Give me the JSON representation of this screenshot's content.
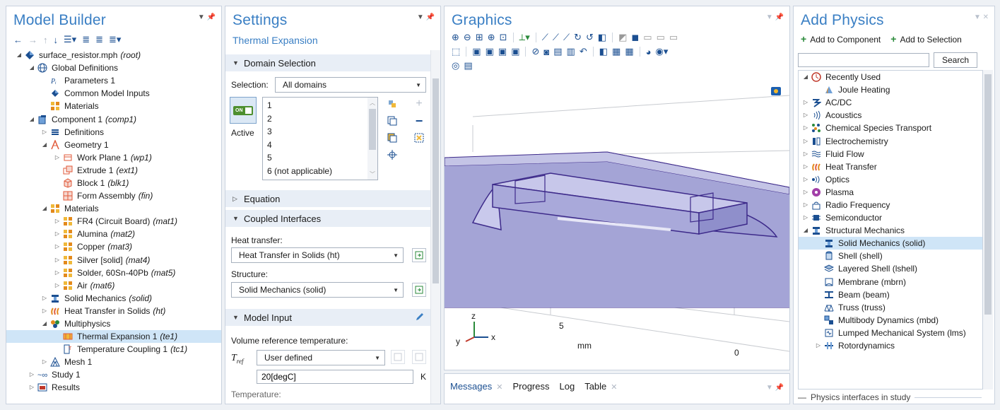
{
  "model_builder": {
    "title": "Model Builder",
    "tree": [
      {
        "depth": 0,
        "expanded": true,
        "icon": "model-root-icon",
        "label": "surface_resistor.mph",
        "tag": "(root)"
      },
      {
        "depth": 1,
        "expanded": true,
        "icon": "globe-icon",
        "label": "Global Definitions",
        "tag": ""
      },
      {
        "depth": 2,
        "expanded": null,
        "icon": "parameters-icon",
        "label": "Parameters 1",
        "tag": ""
      },
      {
        "depth": 2,
        "expanded": null,
        "icon": "common-inputs-icon",
        "label": "Common Model Inputs",
        "tag": ""
      },
      {
        "depth": 2,
        "expanded": null,
        "icon": "materials-icon",
        "label": "Materials",
        "tag": ""
      },
      {
        "depth": 1,
        "expanded": true,
        "icon": "component-icon",
        "label": "Component 1",
        "tag": "(comp1)"
      },
      {
        "depth": 2,
        "expanded": false,
        "icon": "definitions-icon",
        "label": "Definitions",
        "tag": ""
      },
      {
        "depth": 2,
        "expanded": true,
        "icon": "geometry-icon",
        "label": "Geometry 1",
        "tag": ""
      },
      {
        "depth": 3,
        "expanded": false,
        "icon": "work-plane-icon",
        "label": "Work Plane 1",
        "tag": "(wp1)"
      },
      {
        "depth": 3,
        "expanded": null,
        "icon": "extrude-icon",
        "label": "Extrude 1",
        "tag": "(ext1)"
      },
      {
        "depth": 3,
        "expanded": null,
        "icon": "block-icon",
        "label": "Block 1",
        "tag": "(blk1)"
      },
      {
        "depth": 3,
        "expanded": null,
        "icon": "form-assembly-icon",
        "label": "Form Assembly",
        "tag": "(fin)"
      },
      {
        "depth": 2,
        "expanded": true,
        "icon": "materials-icon",
        "label": "Materials",
        "tag": ""
      },
      {
        "depth": 3,
        "expanded": false,
        "icon": "material-icon",
        "label": "FR4 (Circuit Board)",
        "tag": "(mat1)"
      },
      {
        "depth": 3,
        "expanded": false,
        "icon": "material-icon",
        "label": "Alumina",
        "tag": "(mat2)"
      },
      {
        "depth": 3,
        "expanded": false,
        "icon": "material-icon",
        "label": "Copper",
        "tag": "(mat3)"
      },
      {
        "depth": 3,
        "expanded": false,
        "icon": "material-icon",
        "label": "Silver [solid]",
        "tag": "(mat4)"
      },
      {
        "depth": 3,
        "expanded": false,
        "icon": "material-icon",
        "label": "Solder, 60Sn-40Pb",
        "tag": "(mat5)"
      },
      {
        "depth": 3,
        "expanded": false,
        "icon": "material-icon",
        "label": "Air",
        "tag": "(mat6)"
      },
      {
        "depth": 2,
        "expanded": false,
        "icon": "solid-mechanics-icon",
        "label": "Solid Mechanics",
        "tag": "(solid)"
      },
      {
        "depth": 2,
        "expanded": false,
        "icon": "heat-transfer-icon",
        "label": "Heat Transfer in Solids",
        "tag": "(ht)"
      },
      {
        "depth": 2,
        "expanded": true,
        "icon": "multiphysics-icon",
        "label": "Multiphysics",
        "tag": ""
      },
      {
        "depth": 3,
        "expanded": null,
        "icon": "thermal-expansion-icon",
        "label": "Thermal Expansion 1",
        "tag": "(te1)",
        "selected": true
      },
      {
        "depth": 3,
        "expanded": null,
        "icon": "temperature-coupling-icon",
        "label": "Temperature Coupling 1",
        "tag": "(tc1)"
      },
      {
        "depth": 2,
        "expanded": false,
        "icon": "mesh-icon",
        "label": "Mesh 1",
        "tag": ""
      },
      {
        "depth": 1,
        "expanded": false,
        "icon": "study-icon",
        "label": "Study 1",
        "tag": ""
      },
      {
        "depth": 1,
        "expanded": false,
        "icon": "results-icon",
        "label": "Results",
        "tag": ""
      }
    ]
  },
  "settings": {
    "title": "Settings",
    "subtitle": "Thermal Expansion",
    "domain_selection": {
      "header": "Domain Selection",
      "selection_label": "Selection:",
      "selection_value": "All domains",
      "active_label": "Active",
      "toggle_text": "ON",
      "domains": [
        "1",
        "2",
        "3",
        "4",
        "5",
        "6 (not applicable)"
      ]
    },
    "equation_header": "Equation",
    "coupled_interfaces": {
      "header": "Coupled Interfaces",
      "heat_label": "Heat transfer:",
      "heat_value": "Heat Transfer in Solids (ht)",
      "structure_label": "Structure:",
      "structure_value": "Solid Mechanics (solid)"
    },
    "model_input": {
      "header": "Model Input",
      "vrt_label": "Volume reference temperature:",
      "tref_symbol": "T",
      "tref_sub": "ref",
      "tref_mode": "User defined",
      "tref_value": "20[degC]",
      "tref_unit": "K",
      "temperature_label": "Temperature:"
    }
  },
  "graphics": {
    "title": "Graphics",
    "axis_labels": {
      "z": "z",
      "y": "y",
      "x": "x"
    },
    "scale_labels": {
      "five": "5",
      "unit": "mm",
      "zero": "0"
    }
  },
  "messages": {
    "tabs": [
      {
        "label": "Messages",
        "closable": true,
        "active": true
      },
      {
        "label": "Progress",
        "closable": false,
        "active": false
      },
      {
        "label": "Log",
        "closable": false,
        "active": false
      },
      {
        "label": "Table",
        "closable": true,
        "active": false
      }
    ]
  },
  "add_physics": {
    "title": "Add Physics",
    "add_to_component": "Add to Component",
    "add_to_selection": "Add to Selection",
    "search_label": "Search",
    "footer": "Physics interfaces in study",
    "tree": [
      {
        "depth": 0,
        "expanded": true,
        "icon": "recently-used-icon",
        "label": "Recently Used"
      },
      {
        "depth": 1,
        "expanded": null,
        "icon": "joule-heating-icon",
        "label": "Joule Heating"
      },
      {
        "depth": 0,
        "expanded": false,
        "icon": "acdc-icon",
        "label": "AC/DC"
      },
      {
        "depth": 0,
        "expanded": false,
        "icon": "acoustics-icon",
        "label": "Acoustics"
      },
      {
        "depth": 0,
        "expanded": false,
        "icon": "chemical-species-icon",
        "label": "Chemical Species Transport"
      },
      {
        "depth": 0,
        "expanded": false,
        "icon": "electrochemistry-icon",
        "label": "Electrochemistry"
      },
      {
        "depth": 0,
        "expanded": false,
        "icon": "fluid-flow-icon",
        "label": "Fluid Flow"
      },
      {
        "depth": 0,
        "expanded": false,
        "icon": "heat-transfer-icon",
        "label": "Heat Transfer"
      },
      {
        "depth": 0,
        "expanded": false,
        "icon": "optics-icon",
        "label": "Optics"
      },
      {
        "depth": 0,
        "expanded": false,
        "icon": "plasma-icon",
        "label": "Plasma"
      },
      {
        "depth": 0,
        "expanded": false,
        "icon": "radio-frequency-icon",
        "label": "Radio Frequency"
      },
      {
        "depth": 0,
        "expanded": false,
        "icon": "semiconductor-icon",
        "label": "Semiconductor"
      },
      {
        "depth": 0,
        "expanded": true,
        "icon": "structural-mechanics-icon",
        "label": "Structural Mechanics"
      },
      {
        "depth": 1,
        "expanded": null,
        "icon": "solid-mechanics-icon",
        "label": "Solid Mechanics (solid)",
        "selected": true
      },
      {
        "depth": 1,
        "expanded": null,
        "icon": "shell-icon",
        "label": "Shell (shell)"
      },
      {
        "depth": 1,
        "expanded": null,
        "icon": "layered-shell-icon",
        "label": "Layered Shell (lshell)"
      },
      {
        "depth": 1,
        "expanded": null,
        "icon": "membrane-icon",
        "label": "Membrane (mbrn)"
      },
      {
        "depth": 1,
        "expanded": null,
        "icon": "beam-icon",
        "label": "Beam (beam)"
      },
      {
        "depth": 1,
        "expanded": null,
        "icon": "truss-icon",
        "label": "Truss (truss)"
      },
      {
        "depth": 1,
        "expanded": null,
        "icon": "multibody-icon",
        "label": "Multibody Dynamics (mbd)"
      },
      {
        "depth": 1,
        "expanded": null,
        "icon": "lumped-mechanical-icon",
        "label": "Lumped Mechanical System (lms)"
      },
      {
        "depth": 1,
        "expanded": false,
        "icon": "rotordynamics-icon",
        "label": "Rotordynamics"
      }
    ]
  },
  "colors": {
    "accent": "#3a7fc4",
    "selection": "#cfe5f7",
    "model_fill": "#b3b3de",
    "model_edge": "#3d2a8a"
  }
}
